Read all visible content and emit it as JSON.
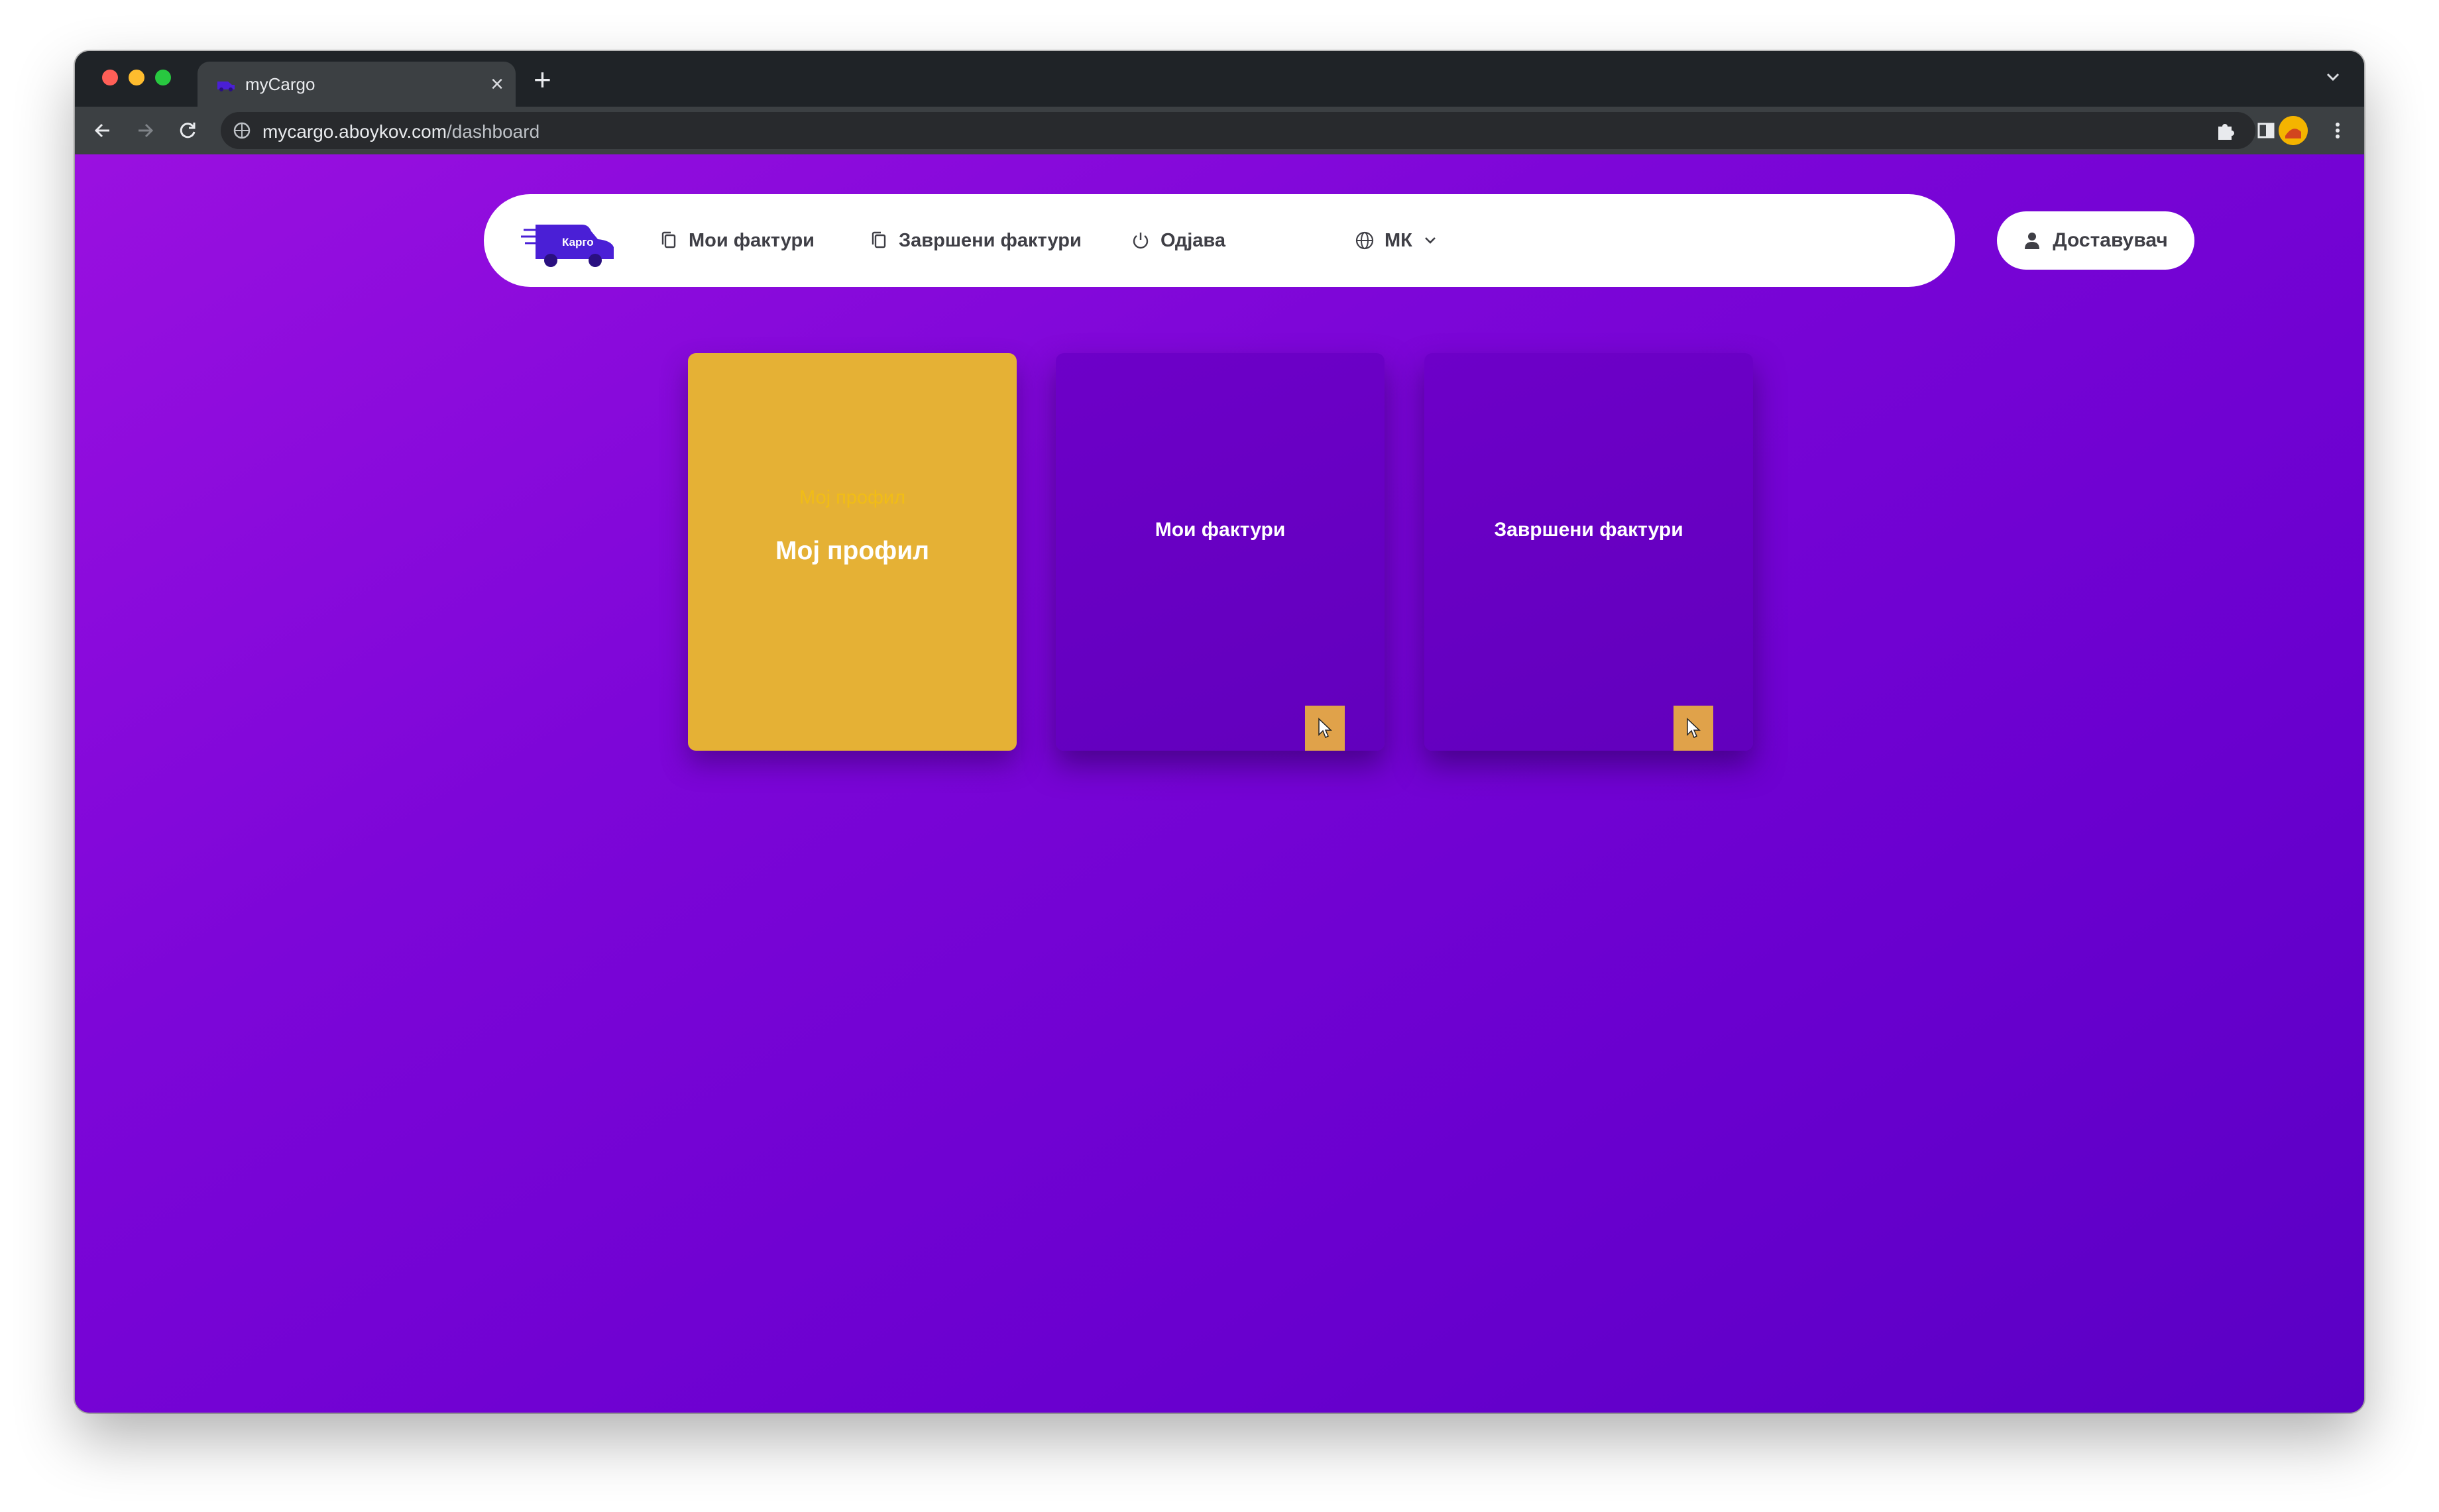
{
  "browser": {
    "tab_title": "myCargo",
    "url_host": "mycargo.aboykov.com",
    "url_path": "/dashboard",
    "icons": [
      "back-arrow-icon",
      "forward-arrow-icon",
      "reload-icon",
      "site-info-icon",
      "extensions-icon",
      "side-panel-icon",
      "profile-avatar",
      "kebab-menu-icon"
    ]
  },
  "navbar": {
    "logo_text": "Карго",
    "items": [
      {
        "label": "Мои фактури",
        "icon": "copy-icon"
      },
      {
        "label": "Завршени фактури",
        "icon": "copy-icon"
      },
      {
        "label": "Одјава",
        "icon": "power-icon"
      },
      {
        "label": "МК",
        "icon": "globe-icon"
      }
    ],
    "user_role": "Доставувач"
  },
  "cards": {
    "profile_ghost": "Мој профил",
    "profile_title": "Мој профил",
    "invoices_title": "Мои фактури",
    "finished_title": "Завршени фактури"
  },
  "colors": {
    "page_gradient": [
      "#9a10e0",
      "#5a00c4"
    ],
    "accent_yellow": "#e5b135",
    "card_purple": "#6800c4",
    "action_orange": "#e0a24a"
  }
}
